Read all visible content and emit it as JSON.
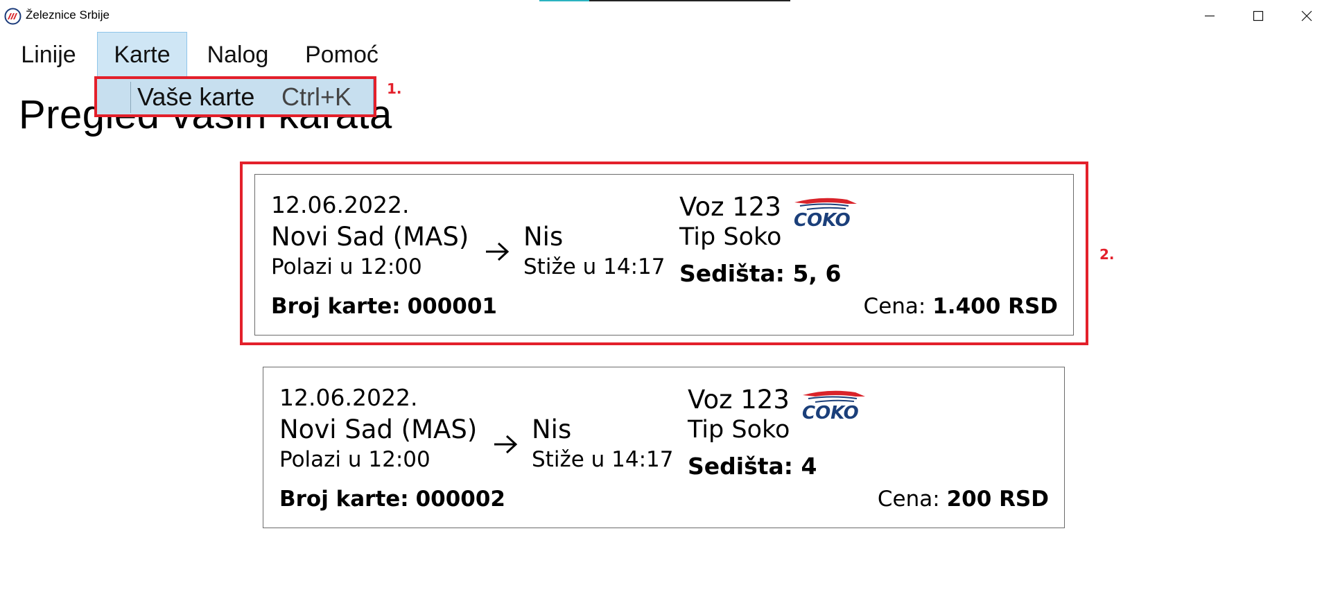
{
  "window": {
    "title": "Železnice Srbije",
    "accent_color": "#2bb3c0",
    "controls": [
      "minimize-icon",
      "maximize-icon",
      "close-icon"
    ]
  },
  "menu": {
    "items": [
      {
        "label": "Linije"
      },
      {
        "label": "Karte"
      },
      {
        "label": "Nalog"
      },
      {
        "label": "Pomoć"
      }
    ],
    "active_index": 1,
    "dropdown": {
      "label": "Vaše karte",
      "shortcut": "Ctrl+K"
    }
  },
  "page": {
    "title": "Pregled vaših karata"
  },
  "annotations": {
    "label_1": "1.",
    "label_2": "2.",
    "color": "#e3202b"
  },
  "tickets": [
    {
      "date": "12.06.2022.",
      "from": "Novi Sad (MAS)",
      "departure": "Polazi u 12:00",
      "to": "Nis",
      "arrival": "Stiže u 14:17",
      "train": "Voz 123",
      "type": "Tip Soko",
      "seats": "Sedišta: 5, 6",
      "number_label": "Broj karte:",
      "number_value": "000001",
      "price_label": "Cena:",
      "price_value": "1.400 RSD",
      "logo_text": "COKO"
    },
    {
      "date": "12.06.2022.",
      "from": "Novi Sad (MAS)",
      "departure": "Polazi u 12:00",
      "to": "Nis",
      "arrival": "Stiže u 14:17",
      "train": "Voz 123",
      "type": "Tip Soko",
      "seats": "Sedišta: 4",
      "number_label": "Broj karte:",
      "number_value": "000002",
      "price_label": "Cena:",
      "price_value": "200 RSD",
      "logo_text": "COKO"
    }
  ]
}
